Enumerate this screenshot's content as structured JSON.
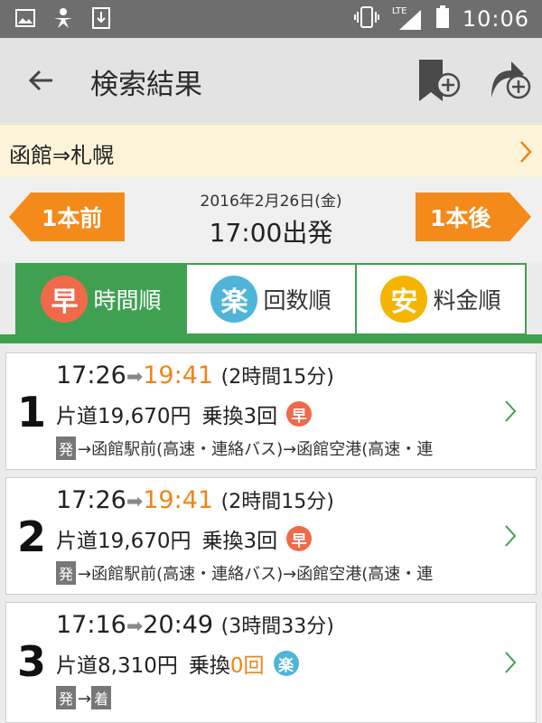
{
  "status_bar": {
    "time": "10:06",
    "network": "LTE",
    "left_icons": [
      "image-icon",
      "person-icon",
      "download-icon"
    ],
    "right_icons": [
      "vibrate-icon",
      "signal-icon",
      "battery-icon"
    ]
  },
  "app_bar": {
    "title": "検索結果",
    "back_icon": "back-arrow-icon",
    "actions": [
      "bookmark-add-icon",
      "share-add-icon"
    ]
  },
  "route": {
    "text": "函館⇒札幌"
  },
  "search": {
    "date": "2016年2月26日(金)",
    "departure": "17:00出発",
    "prev_label": "1本前",
    "next_label": "1本後"
  },
  "sort_tabs": [
    {
      "badge": "早",
      "label": "時間順",
      "active": true,
      "color": "#f06a4a"
    },
    {
      "badge": "楽",
      "label": "回数順",
      "active": false,
      "color": "#4eb5d9"
    },
    {
      "badge": "安",
      "label": "料金順",
      "active": false,
      "color": "#f4b400"
    }
  ],
  "results": [
    {
      "num": "1",
      "dep": "17:26",
      "arrow": "➡",
      "arr": "19:41",
      "duration": "(2時間15分)",
      "fare": "片道19,670円",
      "transfer_prefix": "乗換",
      "transfer_count": "3回",
      "badge": "早",
      "badge_color": "#f06a4a",
      "path_tag": "発",
      "path_text": "→函館駅前(高速・連絡バス)→函館空港(高速・連"
    },
    {
      "num": "2",
      "dep": "17:26",
      "arrow": "➡",
      "arr": "19:41",
      "duration": "(2時間15分)",
      "fare": "片道19,670円",
      "transfer_prefix": "乗換",
      "transfer_count": "3回",
      "badge": "早",
      "badge_color": "#f06a4a",
      "path_tag": "発",
      "path_text": "→函館駅前(高速・連絡バス)→函館空港(高速・連"
    },
    {
      "num": "3",
      "dep": "17:16",
      "arrow": "➡",
      "arr": "20:49",
      "duration": "(3時間33分)",
      "fare": "片道8,310円",
      "transfer_prefix": "乗換",
      "transfer_count": "0回",
      "badge": "楽",
      "badge_color": "#4eb5d9",
      "path_tag": "発",
      "path_arrow": "→",
      "path_tag2": "着"
    }
  ],
  "colors": {
    "accent_green": "#3fa052",
    "orange": "#f08419",
    "route_bg": "#fdf3d8"
  }
}
